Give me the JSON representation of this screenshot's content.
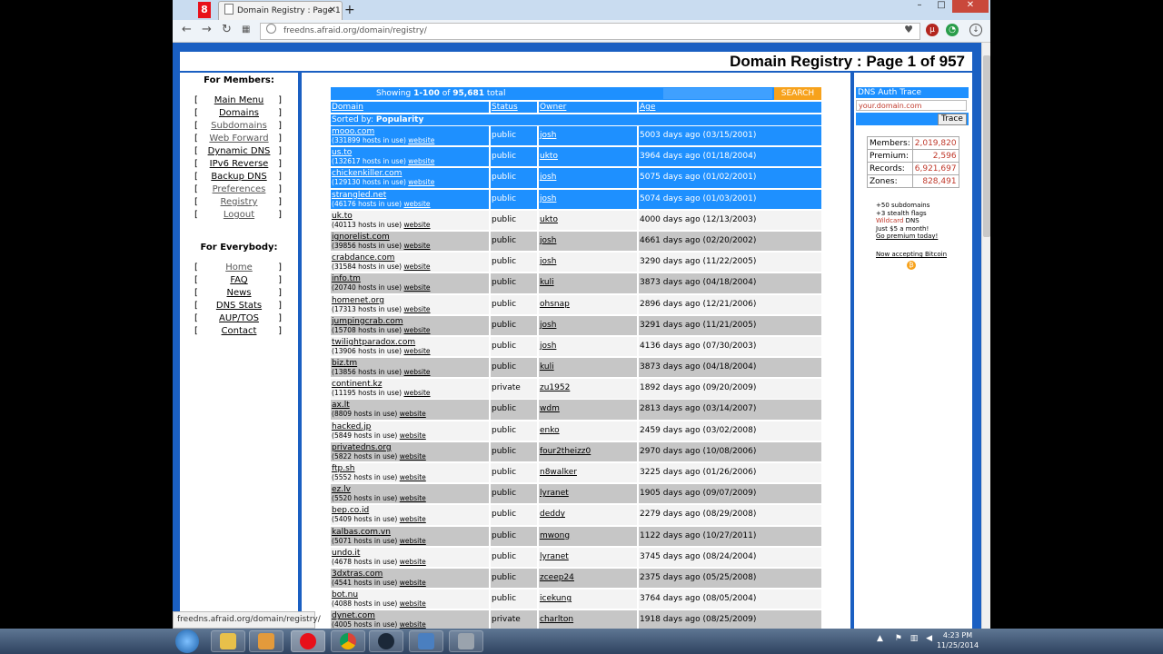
{
  "browser": {
    "tab_title": "Domain Registry : Page 1",
    "tab_close": "✕",
    "new_tab": "+",
    "url": "freedns.afraid.org/domain/registry/",
    "status_url": "freedns.afraid.org/domain/registry/"
  },
  "page": {
    "title": "Domain Registry : Page 1 of 957"
  },
  "members": {
    "heading": "For Members:",
    "items": [
      "Main Menu",
      "Domains",
      "Subdomains",
      "Web Forward",
      "Dynamic DNS",
      "IPv6 Reverse",
      "Backup DNS",
      "Preferences",
      "Registry",
      "Logout"
    ]
  },
  "everybody": {
    "heading": "For Everybody:",
    "items": [
      "Home",
      "FAQ",
      "News",
      "DNS Stats",
      "AUP/TOS",
      "Contact"
    ]
  },
  "registry": {
    "showing_prefix": "Showing ",
    "showing_range": "1-100",
    "showing_of": " of ",
    "showing_total": "95,681",
    "showing_suffix": " total",
    "search_button": "SEARCH",
    "col_domain": "Domain",
    "col_status": "Status",
    "col_owner": "Owner",
    "col_age": "Age",
    "sorted_prefix": "Sorted by: ",
    "sorted_value": "Popularity",
    "hosts_suffix": " hosts in use) ",
    "website_label": "website",
    "rows": [
      {
        "domain": "mooo.com",
        "hosts": "331899",
        "status": "public",
        "owner": "josh",
        "age": "5003 days ago (03/15/2001)",
        "style": "hl"
      },
      {
        "domain": "us.to",
        "hosts": "132617",
        "status": "public",
        "owner": "ukto",
        "age": "3964 days ago (01/18/2004)",
        "style": "hl"
      },
      {
        "domain": "chickenkiller.com",
        "hosts": "129130",
        "status": "public",
        "owner": "josh",
        "age": "5075 days ago (01/02/2001)",
        "style": "hl"
      },
      {
        "domain": "strangled.net",
        "hosts": "46176",
        "status": "public",
        "owner": "josh",
        "age": "5074 days ago (01/03/2001)",
        "style": "hl"
      },
      {
        "domain": "uk.to",
        "hosts": "40113",
        "status": "public",
        "owner": "ukto",
        "age": "4000 days ago (12/13/2003)",
        "style": "light"
      },
      {
        "domain": "ignorelist.com",
        "hosts": "39856",
        "status": "public",
        "owner": "josh",
        "age": "4661 days ago (02/20/2002)",
        "style": "dark"
      },
      {
        "domain": "crabdance.com",
        "hosts": "31584",
        "status": "public",
        "owner": "josh",
        "age": "3290 days ago (11/22/2005)",
        "style": "light"
      },
      {
        "domain": "info.tm",
        "hosts": "20740",
        "status": "public",
        "owner": "kuli",
        "age": "3873 days ago (04/18/2004)",
        "style": "dark"
      },
      {
        "domain": "homenet.org",
        "hosts": "17313",
        "status": "public",
        "owner": "ohsnap",
        "age": "2896 days ago (12/21/2006)",
        "style": "light"
      },
      {
        "domain": "jumpingcrab.com",
        "hosts": "15708",
        "status": "public",
        "owner": "josh",
        "age": "3291 days ago (11/21/2005)",
        "style": "dark"
      },
      {
        "domain": "twilightparadox.com",
        "hosts": "13906",
        "status": "public",
        "owner": "josh",
        "age": "4136 days ago (07/30/2003)",
        "style": "light"
      },
      {
        "domain": "biz.tm",
        "hosts": "13856",
        "status": "public",
        "owner": "kuli",
        "age": "3873 days ago (04/18/2004)",
        "style": "dark"
      },
      {
        "domain": "continent.kz",
        "hosts": "11195",
        "status": "private",
        "owner": "zu1952",
        "age": "1892 days ago (09/20/2009)",
        "style": "light"
      },
      {
        "domain": "ax.lt",
        "hosts": "8809",
        "status": "public",
        "owner": "wdm",
        "age": "2813 days ago (03/14/2007)",
        "style": "dark"
      },
      {
        "domain": "hacked.jp",
        "hosts": "5849",
        "status": "public",
        "owner": "enko",
        "age": "2459 days ago (03/02/2008)",
        "style": "light"
      },
      {
        "domain": "privatedns.org",
        "hosts": "5822",
        "status": "public",
        "owner": "four2theizz0",
        "age": "2970 days ago (10/08/2006)",
        "style": "dark"
      },
      {
        "domain": "ftp.sh",
        "hosts": "5552",
        "status": "public",
        "owner": "n8walker",
        "age": "3225 days ago (01/26/2006)",
        "style": "light"
      },
      {
        "domain": "ez.lv",
        "hosts": "5520",
        "status": "public",
        "owner": "lyranet",
        "age": "1905 days ago (09/07/2009)",
        "style": "dark"
      },
      {
        "domain": "bep.co.id",
        "hosts": "5409",
        "status": "public",
        "owner": "deddy",
        "age": "2279 days ago (08/29/2008)",
        "style": "light"
      },
      {
        "domain": "kalbas.com.vn",
        "hosts": "5071",
        "status": "public",
        "owner": "mwong",
        "age": "1122 days ago (10/27/2011)",
        "style": "dark"
      },
      {
        "domain": "undo.it",
        "hosts": "4678",
        "status": "public",
        "owner": "lyranet",
        "age": "3745 days ago (08/24/2004)",
        "style": "light"
      },
      {
        "domain": "3dxtras.com",
        "hosts": "4541",
        "status": "public",
        "owner": "zceep24",
        "age": "2375 days ago (05/25/2008)",
        "style": "dark"
      },
      {
        "domain": "bot.nu",
        "hosts": "4088",
        "status": "public",
        "owner": "icekung",
        "age": "3764 days ago (08/05/2004)",
        "style": "light"
      },
      {
        "domain": "dynet.com",
        "hosts": "4005",
        "status": "private",
        "owner": "charlton",
        "age": "1918 days ago (08/25/2009)",
        "style": "dark"
      }
    ]
  },
  "trace": {
    "heading": "DNS Auth Trace",
    "placeholder": "your.domain.com",
    "button": "Trace"
  },
  "stats": {
    "rows": [
      {
        "label": "Members:",
        "value": "2,019,820"
      },
      {
        "label": "Premium:",
        "value": "2,596"
      },
      {
        "label": "Records:",
        "value": "6,921,697"
      },
      {
        "label": "Zones:",
        "value": "828,491"
      }
    ]
  },
  "promo": {
    "line1": "+50 subdomains",
    "line2": "+3 stealth flags",
    "line3_wild": "Wildcard",
    "line3_rest": " DNS",
    "line4": "Just $5 a month!",
    "line5": "Go premium today!",
    "bitcoin": "Now accepting Bitcoin"
  },
  "taskbar": {
    "time": "4:23 PM",
    "date": "11/25/2014"
  },
  "colors": {
    "accent_blue": "#1e90ff",
    "page_blue": "#1a5fc2",
    "search_orange": "#f7a21c",
    "stat_red": "#c0392b"
  }
}
